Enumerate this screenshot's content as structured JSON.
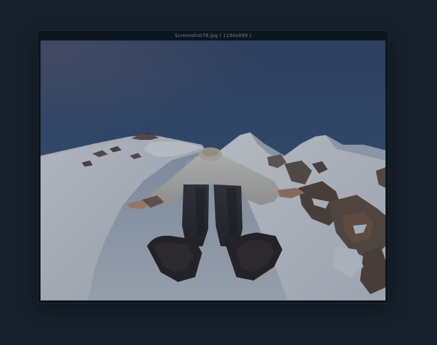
{
  "viewer": {
    "title": "Screenshot78.jpg ( 1194x899 )"
  },
  "image": {
    "subject_icon": "photo-image",
    "colors": {
      "page_background": "#16202b",
      "frame_background": "#0d151d",
      "title_text": "#6f7b86"
    }
  }
}
